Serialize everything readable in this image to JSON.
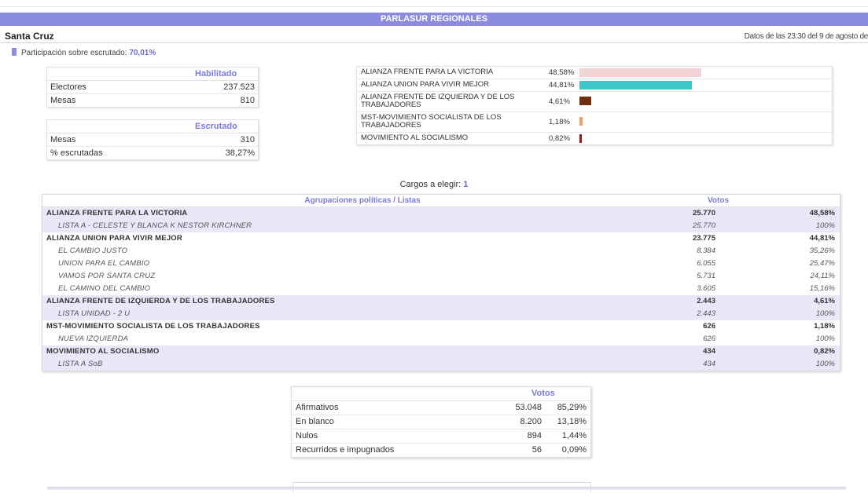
{
  "header": {
    "title": "PARLASUR REGIONALES",
    "region": "Santa Cruz",
    "timestamp": "Datos de las 23:30 del 9 de agosto de",
    "participation_label": "Participación sobre escrutado:",
    "participation_value": "70,01%"
  },
  "habilitado": {
    "heading": "Habilitado",
    "rows": [
      {
        "label": "Electores",
        "value": "237.523"
      },
      {
        "label": "Mesas",
        "value": "810"
      }
    ]
  },
  "escrutado": {
    "heading": "Escrutado",
    "rows": [
      {
        "label": "Mesas",
        "value": "310"
      },
      {
        "label": "% escrutadas",
        "value": "38,27%"
      }
    ]
  },
  "bars": [
    {
      "name": "ALIANZA FRENTE PARA LA VICTORIA",
      "pct": "48,58%",
      "fraction": 0.4858,
      "color": "#f2d4d4"
    },
    {
      "name": "ALIANZA UNION PARA VIVIR MEJOR",
      "pct": "44,81%",
      "fraction": 0.4481,
      "color": "#3cc8c8"
    },
    {
      "name": "ALIANZA FRENTE DE IZQUIERDA Y DE LOS TRABAJADORES",
      "pct": "4,61%",
      "fraction": 0.0461,
      "color": "#6e3010"
    },
    {
      "name": "MST-MOVIMIENTO SOCIALISTA DE LOS TRABAJADORES",
      "pct": "1,18%",
      "fraction": 0.0118,
      "color": "#f0a060"
    },
    {
      "name": "MOVIMIENTO AL SOCIALISMO",
      "pct": "0,82%",
      "fraction": 0.0082,
      "color": "#a01818"
    }
  ],
  "cargos": {
    "label": "Cargos a elegir:",
    "value": "1"
  },
  "results": {
    "col_party": "Agrupaciones políticas / Listas",
    "col_votes": "Votos",
    "rows": [
      {
        "kind": "party",
        "name": "ALIANZA FRENTE PARA LA VICTORIA",
        "votes": "25.770",
        "pct": "48,58%"
      },
      {
        "kind": "list",
        "name": "LISTA A - CELESTE Y BLANCA K NESTOR KIRCHNER",
        "votes": "25.770",
        "pct": "100%"
      },
      {
        "kind": "party",
        "name": "ALIANZA UNION PARA VIVIR MEJOR",
        "votes": "23.775",
        "pct": "44,81%"
      },
      {
        "kind": "list",
        "name": "EL CAMBIO JUSTO",
        "votes": "8.384",
        "pct": "35,26%"
      },
      {
        "kind": "list",
        "name": "UNION PARA EL CAMBIO",
        "votes": "6.055",
        "pct": "25,47%"
      },
      {
        "kind": "list",
        "name": "VAMOS POR SANTA CRUZ",
        "votes": "5.731",
        "pct": "24,11%"
      },
      {
        "kind": "list",
        "name": "EL CAMINO DEL CAMBIO",
        "votes": "3.605",
        "pct": "15,16%"
      },
      {
        "kind": "party",
        "name": "ALIANZA FRENTE DE IZQUIERDA Y DE LOS TRABAJADORES",
        "votes": "2.443",
        "pct": "4,61%"
      },
      {
        "kind": "list",
        "name": "LISTA UNIDAD - 2 U",
        "votes": "2.443",
        "pct": "100%"
      },
      {
        "kind": "party",
        "name": "MST-MOVIMIENTO SOCIALISTA DE LOS TRABAJADORES",
        "votes": "626",
        "pct": "1,18%"
      },
      {
        "kind": "list",
        "name": "NUEVA IZQUIERDA",
        "votes": "626",
        "pct": "100%"
      },
      {
        "kind": "party",
        "name": "MOVIMIENTO AL SOCIALISMO",
        "votes": "434",
        "pct": "0,82%"
      },
      {
        "kind": "list",
        "name": "LISTA A SoB",
        "votes": "434",
        "pct": "100%"
      }
    ]
  },
  "votos": {
    "heading": "Votos",
    "rows": [
      {
        "label": "Afirmativos",
        "votes": "53.048",
        "pct": "85,29%"
      },
      {
        "label": "En blanco",
        "votes": "8.200",
        "pct": "13,18%"
      },
      {
        "label": "Nulos",
        "votes": "894",
        "pct": "1,44%"
      },
      {
        "label": "Recurridos e impugnados",
        "votes": "56",
        "pct": "0,09%"
      }
    ]
  },
  "colors": {
    "accent": "#8c8cdf",
    "row_shade": "#e8e8f8"
  }
}
